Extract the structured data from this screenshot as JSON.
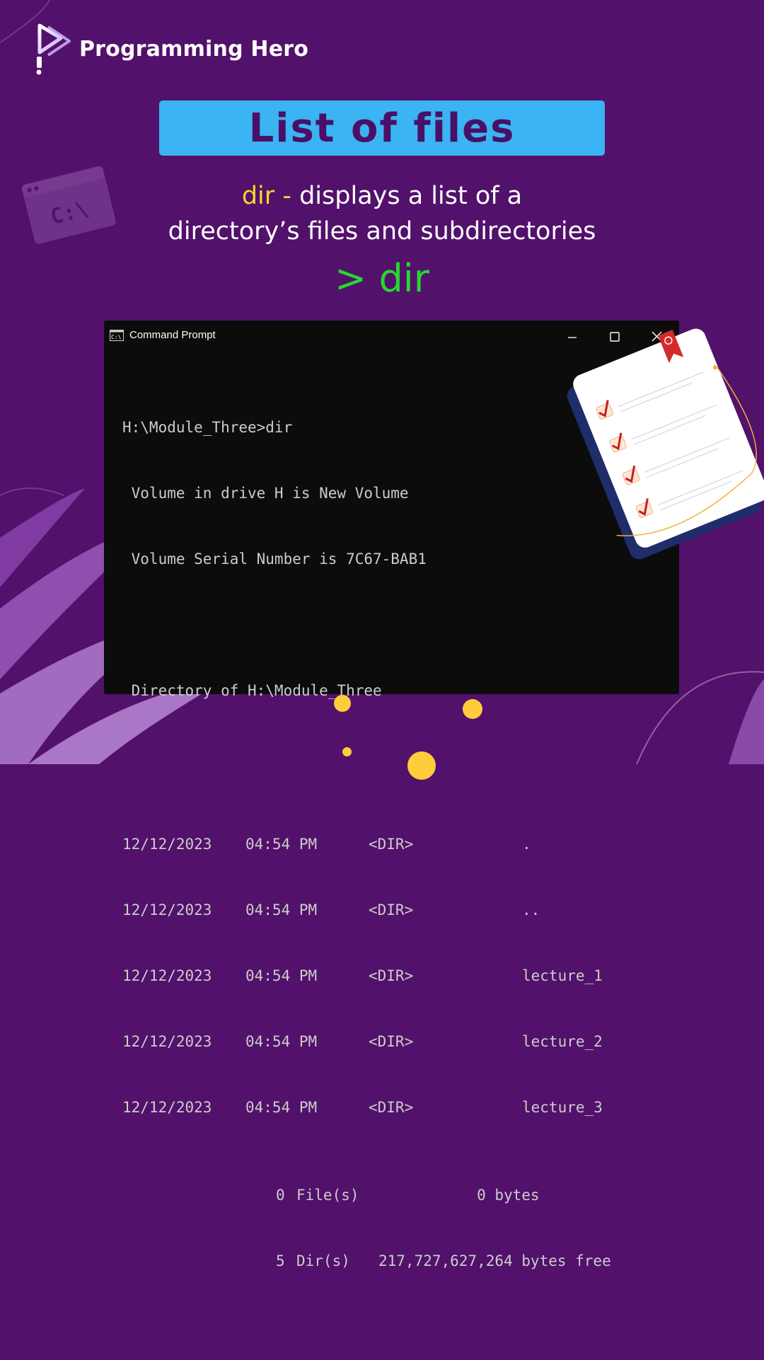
{
  "brand": {
    "name": "Programming Hero",
    "logo_icon": "play-logo-icon"
  },
  "title": "List of files",
  "description": {
    "command": "dir",
    "separator": " - ",
    "text_line1": "displays a list of a",
    "text_line2": "directory’s files and subdirectories"
  },
  "prompt_example": "> dir",
  "terminal": {
    "window_title": "Command Prompt",
    "controls": {
      "minimize": "minimize-icon",
      "maximize": "maximize-icon",
      "close": "close-icon"
    },
    "header_lines": [
      "H:\\Module_Three>dir",
      " Volume in drive H is New Volume",
      " Volume Serial Number is 7C67-BAB1",
      "",
      " Directory of H:\\Module_Three",
      ""
    ],
    "entries": [
      {
        "date": "12/12/2023",
        "time": "04:54 PM",
        "type": "<DIR>",
        "name": "."
      },
      {
        "date": "12/12/2023",
        "time": "04:54 PM",
        "type": "<DIR>",
        "name": ".."
      },
      {
        "date": "12/12/2023",
        "time": "04:54 PM",
        "type": "<DIR>",
        "name": "lecture_1"
      },
      {
        "date": "12/12/2023",
        "time": "04:54 PM",
        "type": "<DIR>",
        "name": "lecture_2"
      },
      {
        "date": "12/12/2023",
        "time": "04:54 PM",
        "type": "<DIR>",
        "name": "lecture_3"
      }
    ],
    "summary": [
      {
        "count": "0",
        "label": "File(s)",
        "value": "           0 bytes"
      },
      {
        "count": "5",
        "label": "Dir(s)",
        "value": "217,727,627,264 bytes free"
      }
    ]
  },
  "decorations": {
    "background_cmd_icon_text": "C:\\",
    "clipboard_icon": "checklist-clipboard-icon"
  },
  "colors": {
    "background": "#52116b",
    "title_box": "#3ab4f2",
    "title_text": "#4a1068",
    "command_highlight": "#ffd428",
    "prompt_green": "#26d82e",
    "terminal_bg": "#0c0c0c",
    "terminal_text": "#cccccc"
  }
}
